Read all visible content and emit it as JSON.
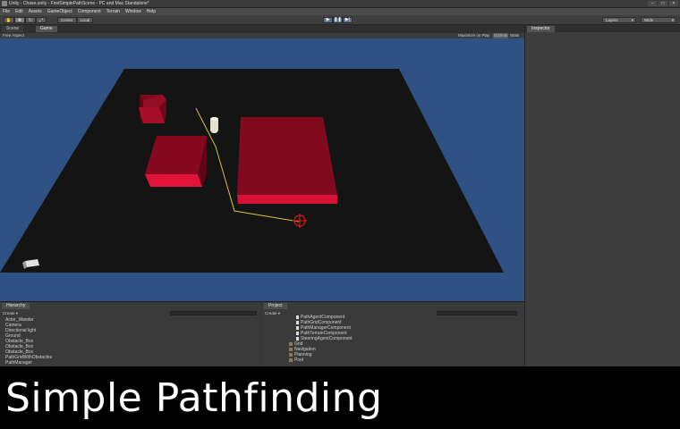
{
  "window": {
    "title": "Unity - Chase.unity - FirstSimplePathScene - PC and Mac Standalone*",
    "controls": [
      "–",
      "□",
      "×"
    ]
  },
  "menu": [
    "File",
    "Edit",
    "Assets",
    "GameObject",
    "Component",
    "Terrain",
    "Window",
    "Help"
  ],
  "toolbar": {
    "tools": [
      "hand-icon",
      "move-icon",
      "rotate-icon",
      "scale-icon"
    ],
    "pivot_label": "Center",
    "space_label": "Local",
    "play_buttons": [
      "▶",
      "❚❚",
      "▶|"
    ],
    "layers_label": "Layers",
    "layout_label": "Wide"
  },
  "scene_panel": {
    "tabs": [
      "Scene",
      "Game"
    ],
    "active_tab": "Game",
    "aspect_label": "Free Aspect",
    "options": [
      "Maximize on Play",
      "Gizmos",
      "Stats"
    ],
    "colors": {
      "sky": "#2f5083",
      "ground": "#141414",
      "obstacle": "#c4102e",
      "path": "#d6c43a"
    }
  },
  "inspector": {
    "tab": "Inspector"
  },
  "hierarchy": {
    "tab": "Hierarchy",
    "create_label": "Create ▾",
    "search_placeholder": "Q▾All",
    "items": [
      "Actor_Wander",
      "Camera",
      "Directional light",
      "Ground",
      "Obstacle_Box",
      "Obstacle_Box",
      "Obstacle_Box",
      "PathGridWithObstacles",
      "PathManager"
    ]
  },
  "project": {
    "tab": "Project",
    "create_label": "Create ▾",
    "search_placeholder": "Q▾All",
    "items": [
      {
        "label": "PathAgentComponent",
        "kind": "file",
        "indent": 2
      },
      {
        "label": "PathGridComponent",
        "kind": "file",
        "indent": 2
      },
      {
        "label": "PathManagerComponent",
        "kind": "file",
        "indent": 2
      },
      {
        "label": "PathTerrainComponent",
        "kind": "file",
        "indent": 2
      },
      {
        "label": "SteeringAgentComponent",
        "kind": "file",
        "indent": 2
      },
      {
        "label": "Grid",
        "kind": "folder",
        "indent": 1
      },
      {
        "label": "Navigation",
        "kind": "folder",
        "indent": 1
      },
      {
        "label": "Planning",
        "kind": "folder",
        "indent": 1
      },
      {
        "label": "Pool",
        "kind": "folder",
        "indent": 1
      }
    ]
  },
  "caption": "Simple Pathfinding"
}
